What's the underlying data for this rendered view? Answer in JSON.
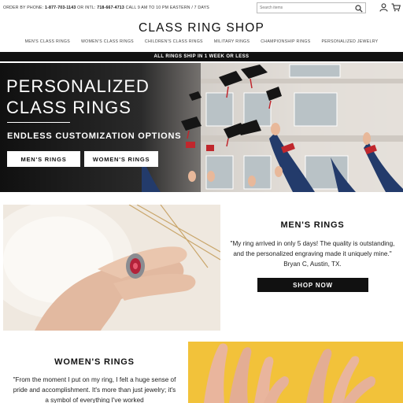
{
  "topbar": {
    "phone_prefix": "ORDER BY PHONE:",
    "phone_number": "1-877-703-1143",
    "intl_prefix": "OR INTL:",
    "intl_number": "718-667-4713",
    "hours": "CALL 9 AM TO 10 PM EASTERN / 7 DAYS",
    "search_placeholder": "Search items"
  },
  "logo": "CLASS RING SHOP",
  "nav": {
    "items": [
      "MEN'S CLASS RINGS",
      "WOMEN'S CLASS RINGS",
      "CHILDREN'S CLASS RINGS",
      "MILITARY RINGS",
      "CHAMPIONSHIP RINGS",
      "PERSONALIZED JEWELRY"
    ]
  },
  "shipping_banner": "ALL RINGS SHIP IN 1 WEEK OR LESS",
  "hero": {
    "title_line1": "PERSONALIZED",
    "title_line2": "CLASS RINGS",
    "subtitle": "ENDLESS CUSTOMIZATION OPTIONS",
    "button_mens": "MEN'S RINGS",
    "button_womens": "WOMEN'S RINGS"
  },
  "mens": {
    "title": "MEN'S RINGS",
    "quote": "\"My ring arrived in only 5 days! The quality is outstanding, and the personalized engraving made it uniquely mine.\" Bryan C, Austin, TX.",
    "button": "SHOP NOW"
  },
  "womens": {
    "title": "WOMEN'S RINGS",
    "quote": "\"From the moment I put on my ring, I felt a huge sense of pride and accomplishment. It's more than just jewelry; it's a symbol of everything I've worked"
  },
  "colors": {
    "black": "#111111",
    "white": "#ffffff",
    "womens_bg": "#f2c23a"
  }
}
